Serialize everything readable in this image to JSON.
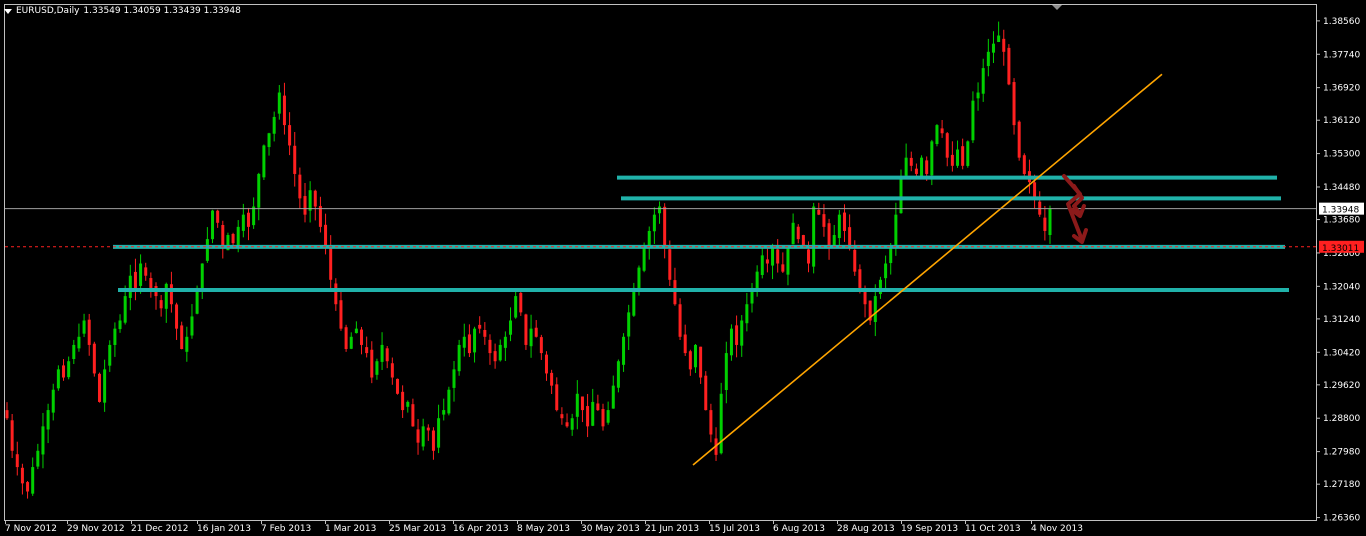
{
  "header": {
    "symbol": "EURUSD,Daily",
    "ohlc": "1.33549 1.34059 1.33439 1.33948"
  },
  "colors": {
    "background": "#000000",
    "frame": "#c0c0c0",
    "bull": "#00d000",
    "bear": "#ff2020",
    "level": "#20b2aa",
    "trendline": "#ffa500",
    "arrow": "#8b1a1a"
  },
  "chart_data": {
    "type": "candlestick",
    "title": "EURUSD,Daily",
    "ylim": [
      1.263,
      1.3895
    ],
    "y_ticks": [
      "1.38560",
      "1.37740",
      "1.36920",
      "1.36120",
      "1.35300",
      "1.34480",
      "1.33680",
      "1.32860",
      "1.32040",
      "1.31240",
      "1.30420",
      "1.29620",
      "1.28800",
      "1.27980",
      "1.27180",
      "1.26360"
    ],
    "x_labels": [
      "7 Nov 2012",
      "29 Nov 2012",
      "21 Dec 2012",
      "16 Jan 2013",
      "7 Feb 2013",
      "1 Mar 2013",
      "25 Mar 2013",
      "16 Apr 2013",
      "8 May 2013",
      "30 May 2013",
      "21 Jun 2013",
      "15 Jul 2013",
      "6 Aug 2013",
      "28 Aug 2013",
      "19 Sep 2013",
      "11 Oct 2013",
      "4 Nov 2013"
    ],
    "bid_label": "1.33948",
    "bid_price": 1.33948,
    "alert_label": "1.33011",
    "alert_price": 1.33011,
    "closes": [
      1.288,
      1.28,
      1.276,
      1.272,
      1.27,
      1.276,
      1.28,
      1.286,
      1.29,
      1.295,
      1.3,
      1.298,
      1.302,
      1.306,
      1.308,
      1.312,
      1.306,
      1.299,
      1.292,
      1.3,
      1.306,
      1.31,
      1.312,
      1.318,
      1.323,
      1.32,
      1.326,
      1.323,
      1.32,
      1.318,
      1.315,
      1.321,
      1.316,
      1.31,
      1.305,
      1.308,
      1.313,
      1.32,
      1.326,
      1.332,
      1.339,
      1.336,
      1.33,
      1.333,
      1.331,
      1.335,
      1.338,
      1.335,
      1.34,
      1.348,
      1.355,
      1.358,
      1.362,
      1.368,
      1.36,
      1.355,
      1.348,
      1.342,
      1.338,
      1.344,
      1.34,
      1.335,
      1.33,
      1.322,
      1.316,
      1.31,
      1.305,
      1.308,
      1.31,
      1.306,
      1.304,
      1.298,
      1.302,
      1.306,
      1.302,
      1.298,
      1.294,
      1.29,
      1.292,
      1.286,
      1.282,
      1.286,
      1.285,
      1.28,
      1.288,
      1.29,
      1.295,
      1.3,
      1.306,
      1.308,
      1.304,
      1.31,
      1.31,
      1.308,
      1.304,
      1.302,
      1.306,
      1.308,
      1.312,
      1.318,
      1.314,
      1.306,
      1.31,
      1.308,
      1.304,
      1.299,
      1.296,
      1.29,
      1.288,
      1.286,
      1.288,
      1.294,
      1.29,
      1.286,
      1.292,
      1.29,
      1.286,
      1.29,
      1.296,
      1.302,
      1.308,
      1.314,
      1.32,
      1.325,
      1.33,
      1.334,
      1.338,
      1.34,
      1.33,
      1.322,
      1.316,
      1.308,
      1.304,
      1.3,
      1.306,
      1.298,
      1.29,
      1.284,
      1.279,
      1.294,
      1.304,
      1.31,
      1.306,
      1.312,
      1.316,
      1.32,
      1.324,
      1.328,
      1.326,
      1.33,
      1.326,
      1.324,
      1.33,
      1.336,
      1.332,
      1.33,
      1.326,
      1.34,
      1.338,
      1.335,
      1.33,
      1.333,
      1.338,
      1.334,
      1.33,
      1.324,
      1.32,
      1.316,
      1.312,
      1.318,
      1.322,
      1.326,
      1.33,
      1.338,
      1.347,
      1.352,
      1.35,
      1.348,
      1.352,
      1.348,
      1.356,
      1.36,
      1.358,
      1.352,
      1.35,
      1.354,
      1.35,
      1.356,
      1.366,
      1.368,
      1.374,
      1.378,
      1.38,
      1.382,
      1.378,
      1.37,
      1.36,
      1.352,
      1.348,
      1.346,
      1.342,
      1.338,
      1.334,
      1.3395
    ],
    "levels": [
      {
        "price": 1.3471,
        "x_start_label": "30 May 2013"
      },
      {
        "price": 1.342,
        "x_start_label": "30 May 2013"
      },
      {
        "price": 1.3301,
        "x_start_label": "21 Dec 2012"
      },
      {
        "price": 1.3195,
        "x_start_label": "29 Nov 2012"
      }
    ],
    "trendline": {
      "from": {
        "date": "21 Jun 2013",
        "price": 1.2765
      },
      "to_price": 1.3725
    }
  }
}
